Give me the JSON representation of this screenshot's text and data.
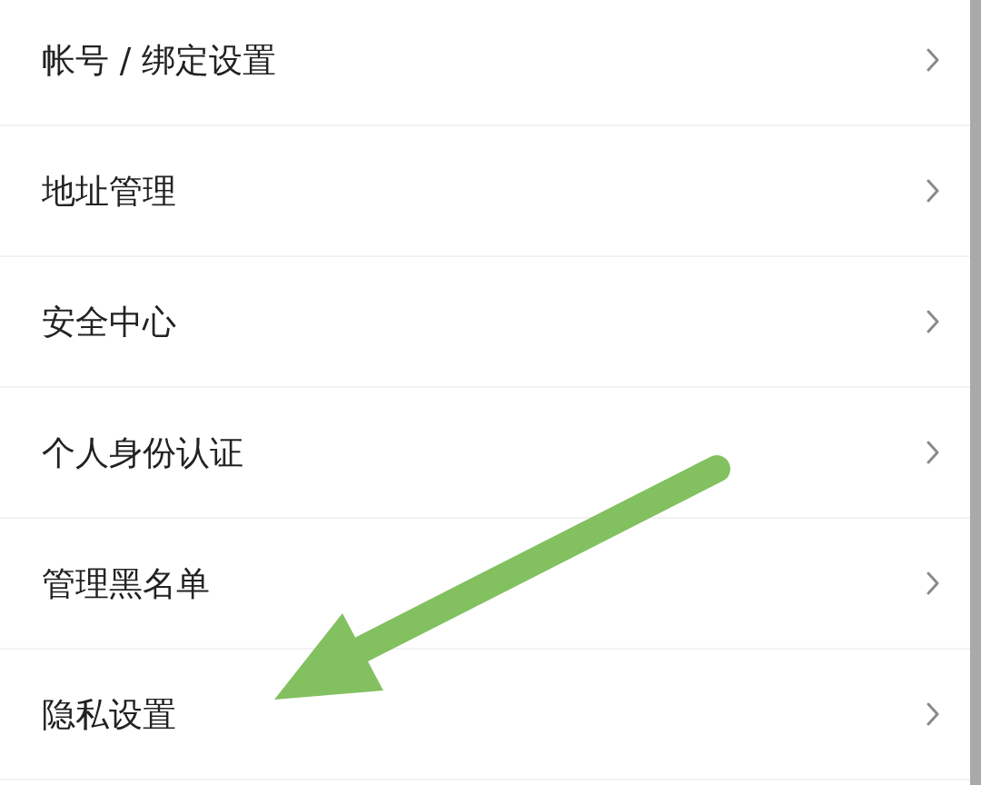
{
  "settings_list": {
    "items": [
      {
        "label": "帐号 / 绑定设置"
      },
      {
        "label": "地址管理"
      },
      {
        "label": "安全中心"
      },
      {
        "label": "个人身份认证"
      },
      {
        "label": "管理黑名单"
      },
      {
        "label": "隐私设置"
      }
    ]
  }
}
